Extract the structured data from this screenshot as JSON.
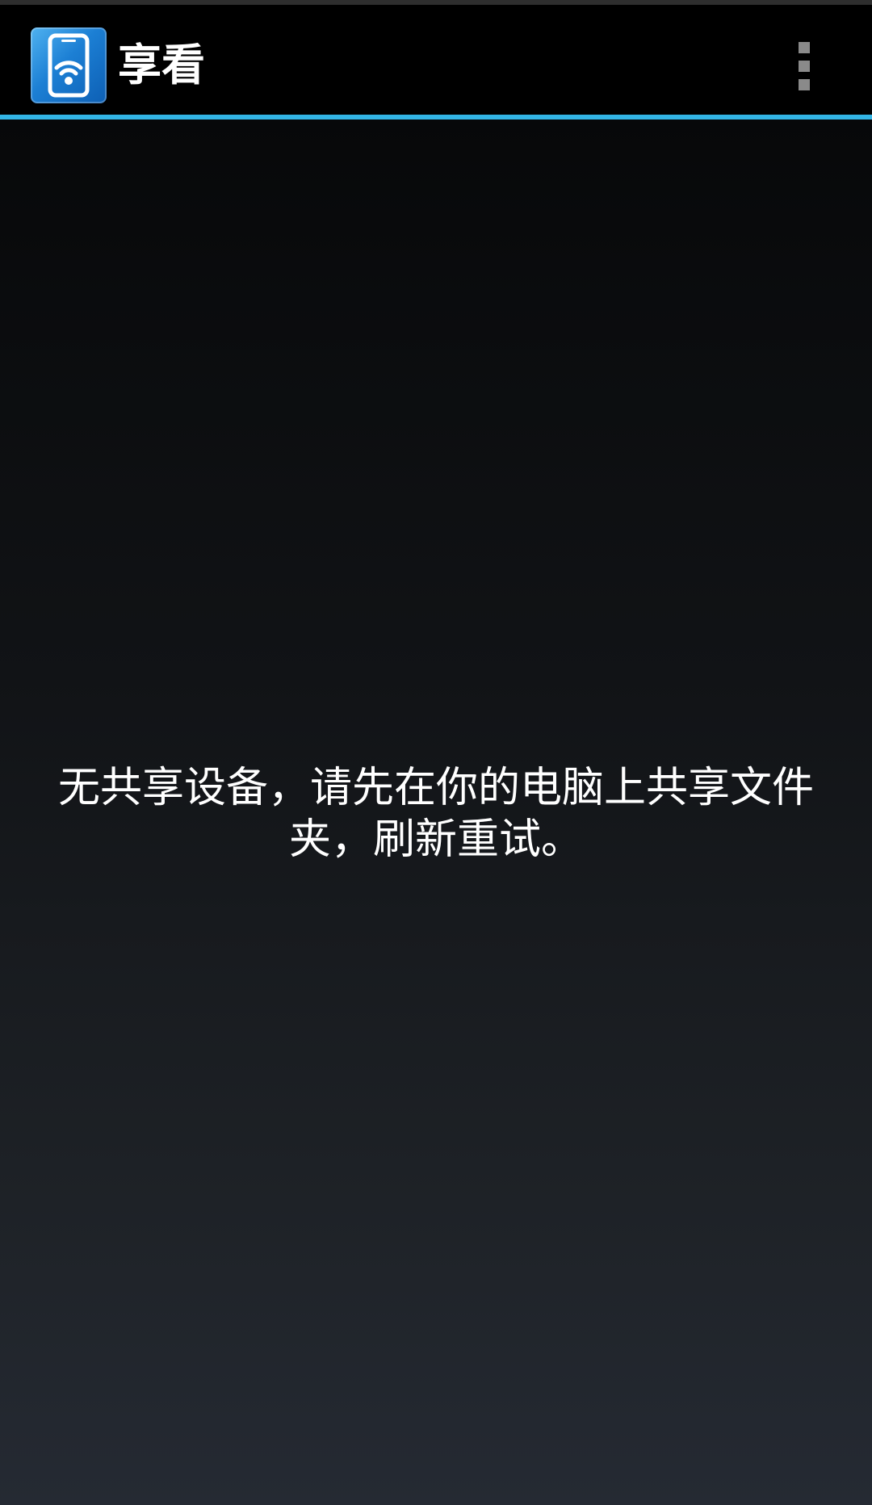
{
  "action_bar": {
    "app_icon": "wifi-phone-icon",
    "title": "享看",
    "overflow_icon": "overflow-menu-icon"
  },
  "colors": {
    "action_bar_background": "#000000",
    "divider_accent": "#33b5e5",
    "app_icon_blue": "#1c7fd4",
    "overflow_dots": "#8a8a8a",
    "text": "#ffffff"
  },
  "main": {
    "empty_message": "无共享设备，请先在你的电脑上共享文件夹，刷新重试。"
  }
}
